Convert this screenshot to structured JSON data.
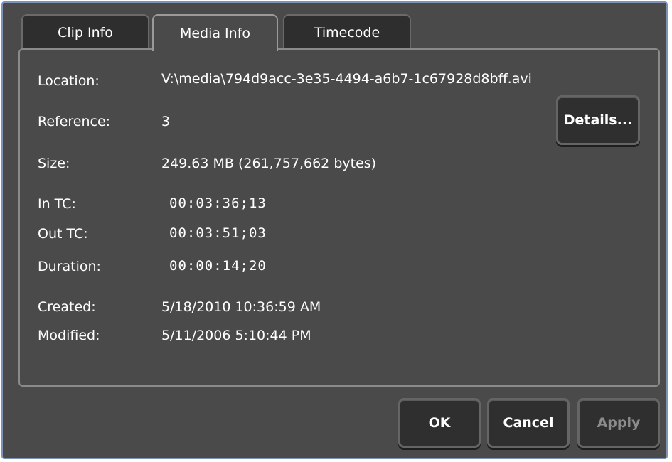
{
  "tabs": [
    {
      "label": "Clip Info",
      "active": false
    },
    {
      "label": "Media Info",
      "active": true
    },
    {
      "label": "Timecode",
      "active": false
    }
  ],
  "fields": {
    "location": {
      "label": "Location:",
      "value": "V:\\media\\794d9acc-3e35-4494-a6b7-1c67928d8bff.avi"
    },
    "reference": {
      "label": "Reference:",
      "value": "3"
    },
    "size": {
      "label": "Size:",
      "value": "249.63 MB (261,757,662 bytes)"
    },
    "in_tc": {
      "label": "In TC:",
      "value": "00:03:36;13"
    },
    "out_tc": {
      "label": "Out TC:",
      "value": "00:03:51;03"
    },
    "duration": {
      "label": "Duration:",
      "value": "00:00:14;20"
    },
    "created": {
      "label": "Created:",
      "value": "5/18/2010 10:36:59 AM"
    },
    "modified": {
      "label": "Modified:",
      "value": "5/11/2006 5:10:44 PM"
    }
  },
  "buttons": {
    "details": "Details...",
    "ok": "OK",
    "cancel": "Cancel",
    "apply": {
      "label": "Apply",
      "enabled": false
    }
  },
  "colors": {
    "background": "#4a4a4a",
    "tab_inactive": "#2e2e2e",
    "button": "#2f2f2f",
    "window_border": "#7e93b5",
    "disabled_text": "#8c8c8c"
  }
}
